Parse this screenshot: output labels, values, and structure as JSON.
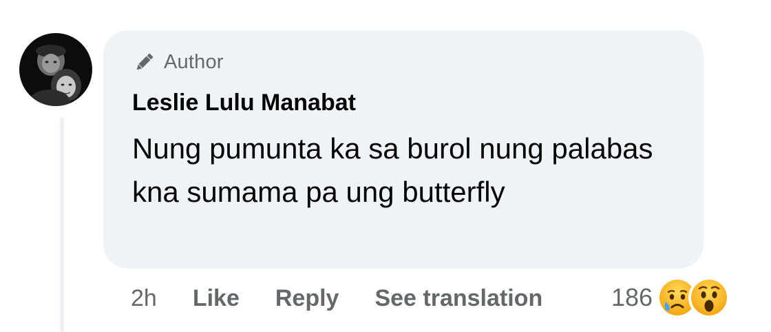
{
  "comment": {
    "author_badge": "Author",
    "commenter_name": "Leslie Lulu Manabat",
    "text": "Nung pumunta ka sa burol nung palabas kna sumama pa ung butterfly",
    "avatar_icon": "avatar-photo",
    "badge_icon": "pencil-icon"
  },
  "actions": {
    "time": "2h",
    "like_label": "Like",
    "reply_label": "Reply",
    "translate_label": "See translation"
  },
  "reactions": {
    "count": "186",
    "icons": [
      "sad-emoji-icon",
      "wow-emoji-icon"
    ]
  },
  "colors": {
    "bubble_bg": "#f0f2f5",
    "secondary_text": "#65676b",
    "primary_text": "#050505",
    "emoji_yellow": "#f7b125"
  }
}
